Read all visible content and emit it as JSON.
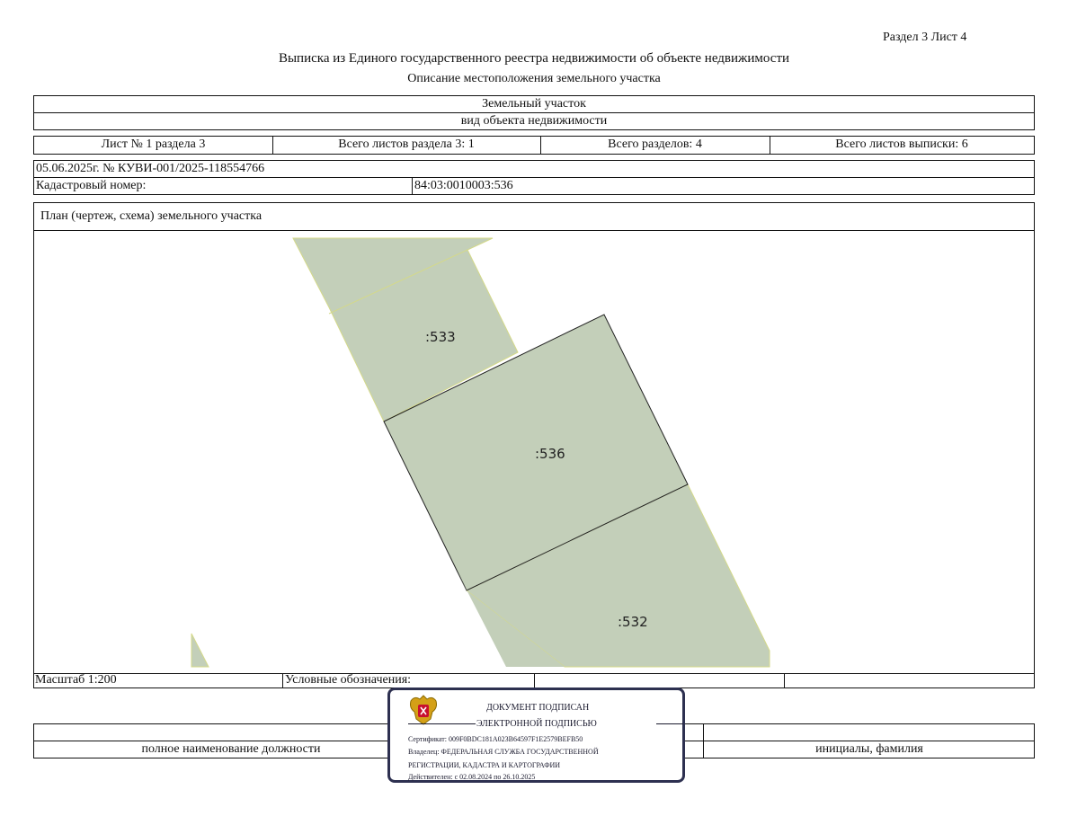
{
  "header": {
    "section_sheet": "Раздел 3    Лист 4",
    "title": "Выписка из Единого государственного реестра недвижимости об объекте недвижимости",
    "subtitle": "Описание местоположения земельного участка"
  },
  "object": {
    "type": "Земельный участок",
    "type_caption": "вид объекта недвижимости"
  },
  "sheets": {
    "sheet_no": "Лист № 1 раздела 3",
    "total_section_sheets": "Всего листов раздела 3: 1",
    "total_sections": "Всего разделов: 4",
    "total_extract_sheets": "Всего листов выписки: 6"
  },
  "record": {
    "date_number": "05.06.2025г. № КУВИ-001/2025-118554766",
    "cadastral_label": "Кадастровый номер:",
    "cadastral_value": "84:03:0010003:536"
  },
  "plan": {
    "title": "План (чертеж, схема) земельного участка",
    "labels": {
      "p533": ":533",
      "p536": ":536",
      "p532": ":532"
    },
    "colors": {
      "parcel_fill": "#c3cfb9",
      "parcel_edge": "#d4d98a",
      "outline": "#222222"
    }
  },
  "legend_row": {
    "scale": "Масштаб 1:200",
    "legend": "Условные обозначения:"
  },
  "signature_row": {
    "position": "полное наименование должности",
    "name": "инициалы, фамилия"
  },
  "stamp": {
    "line1": "ДОКУМЕНТ ПОДПИСАН",
    "line2": "ЭЛЕКТРОННОЙ ПОДПИСЬЮ",
    "certificate": "Сертификат: 009F0BDC181A023B64597F1E2579BEFB50",
    "owner1": "Владелец: ФЕДЕРАЛЬНАЯ СЛУЖБА ГОСУДАРСТВЕННОЙ",
    "owner2": "РЕГИСТРАЦИИ, КАДАСТРА И КАРТОГРАФИИ",
    "valid": "Действителен: с 02.08.2024 по 26.10.2025",
    "emblem": "coat-of-arms-emblem"
  }
}
